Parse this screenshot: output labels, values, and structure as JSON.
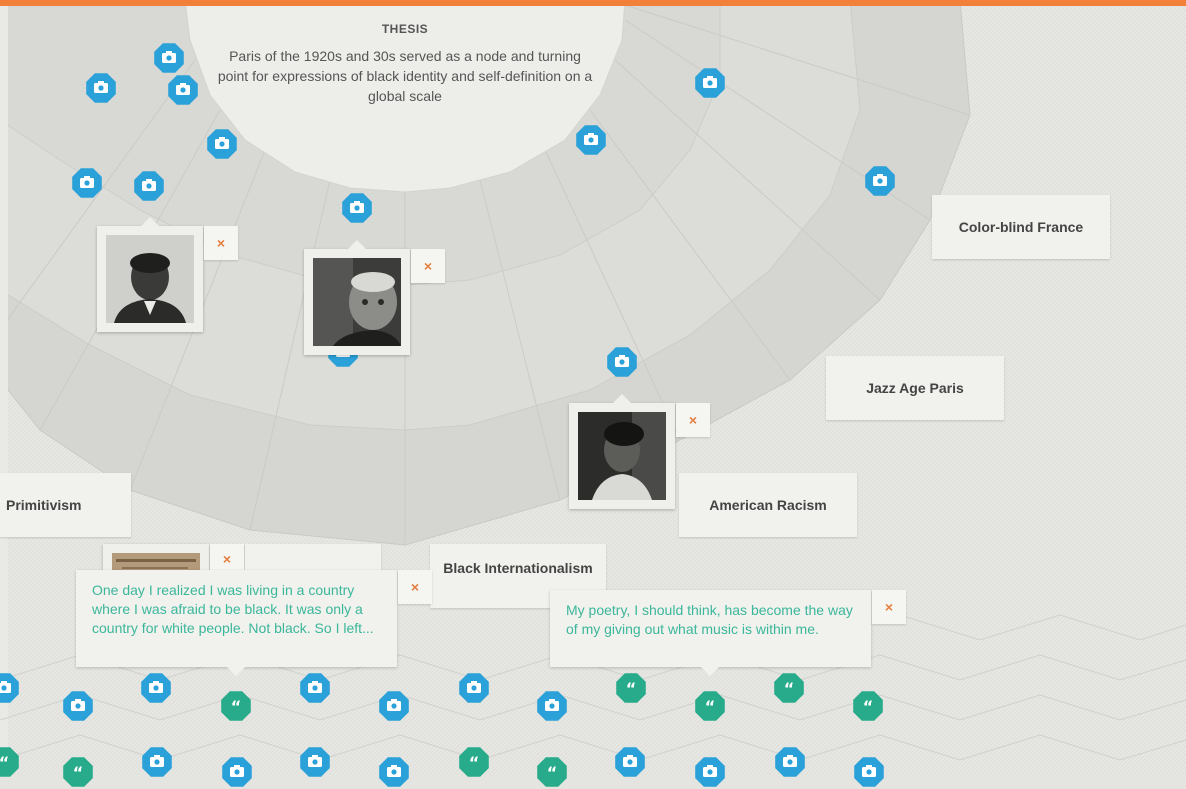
{
  "colors": {
    "accent_orange": "#f0803a",
    "photo_pin_blue": "#2aa1d8",
    "quote_pin_green": "#27ab8a",
    "quote_text_green": "#3bb79a",
    "close_orange": "#e57e3d"
  },
  "thesis": {
    "title": "THESIS",
    "text": "Paris of the 1920s and 30s served as a node and turning point for expressions of black identity and self-definition on a global scale"
  },
  "topics": {
    "color_blind": "Color-blind France",
    "jazz_age": "Jazz Age Paris",
    "american_racism": "American Racism",
    "primitivism": "Primitivism",
    "black_internationalism": "Black Internationalism"
  },
  "photo_cards": [
    {
      "id": "portrait-man-1",
      "icon": "portrait-photo"
    },
    {
      "id": "portrait-man-2",
      "icon": "portrait-photo"
    },
    {
      "id": "portrait-woman",
      "icon": "portrait-photo"
    },
    {
      "id": "document-photo",
      "icon": "document-photo"
    }
  ],
  "close_label": "×",
  "quotes": {
    "left": "One day I realized I was living in a country where I was afraid to be black. It was only a country for white people. Not black. So I left...",
    "right": "My poetry, I should think, has become the way of my giving out what music is within me."
  },
  "icons": {
    "photo_pin": "camera-icon",
    "quote_pin": "quote-icon",
    "close": "close-icon"
  }
}
